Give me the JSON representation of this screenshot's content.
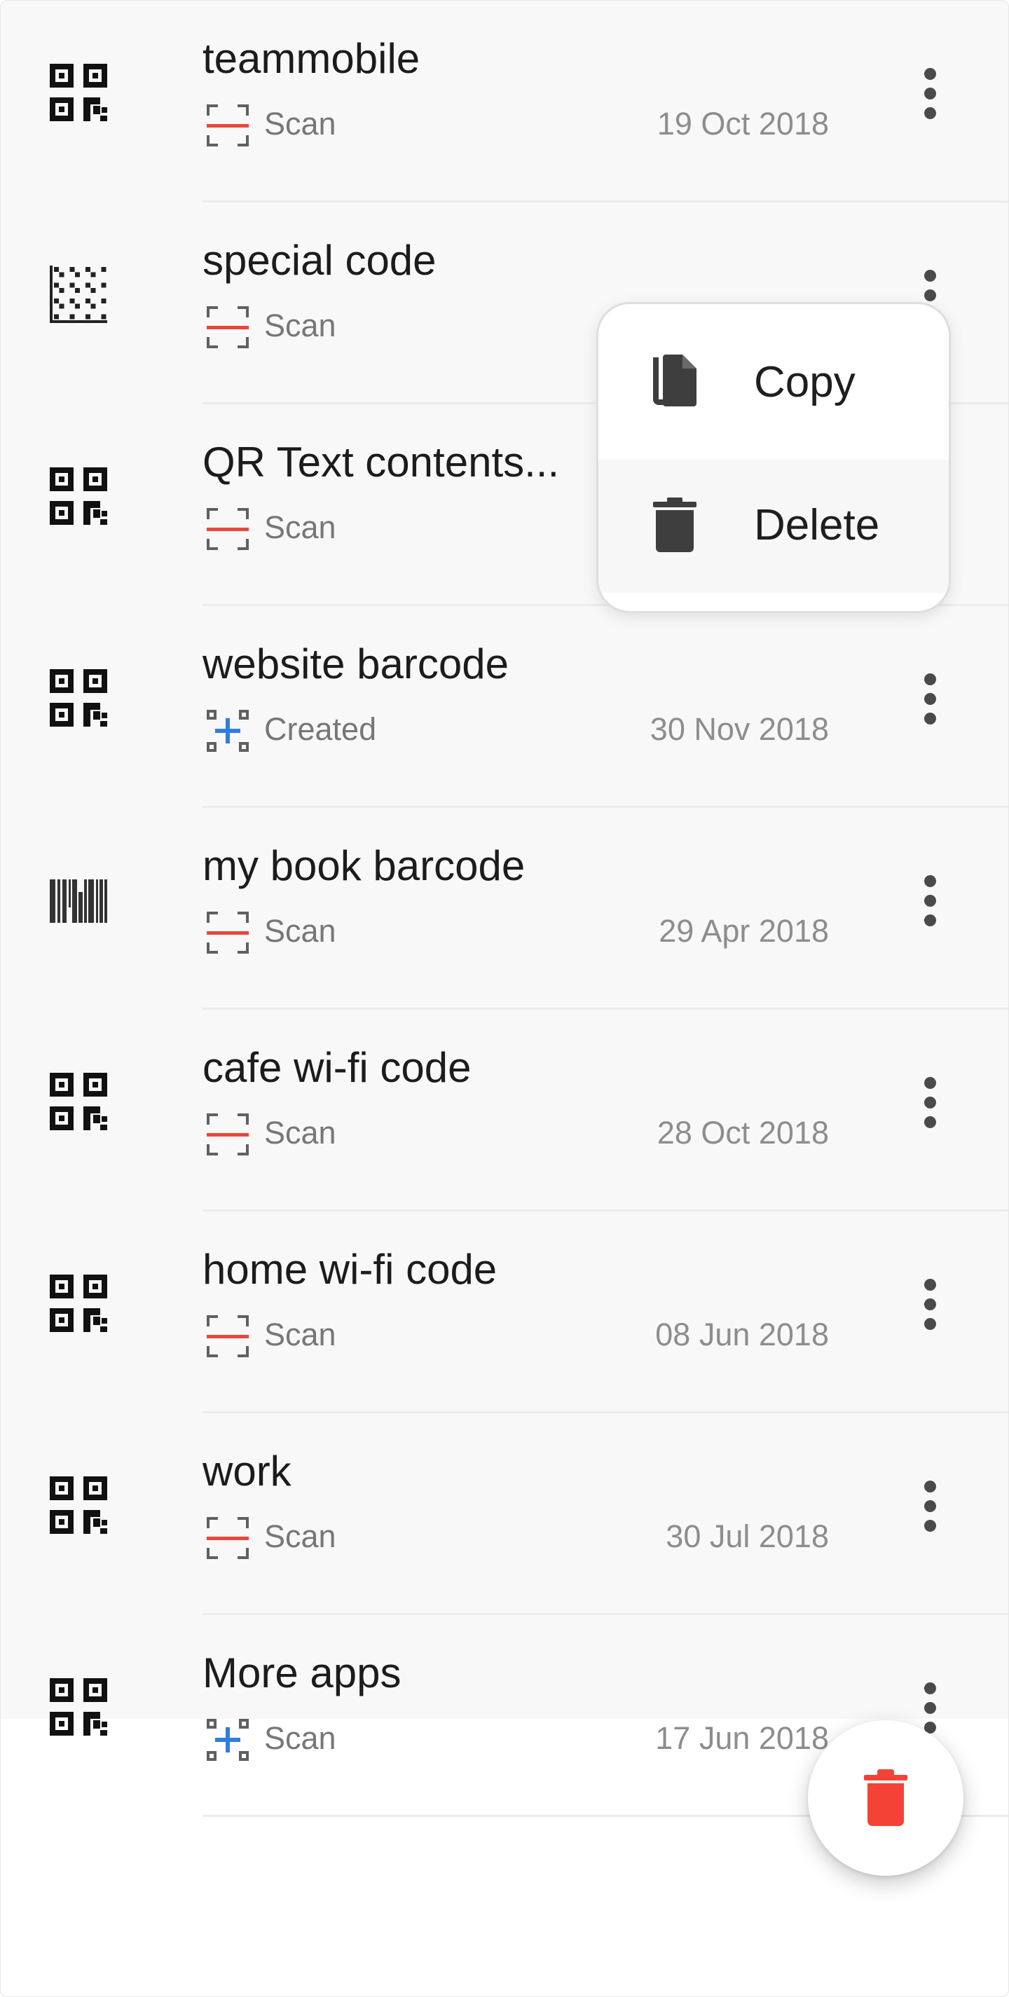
{
  "codes": [
    {
      "title": "teammobile",
      "code_type": "qr",
      "source_icon": "scan-icon",
      "source": "Scan",
      "date": "19 Oct 2018"
    },
    {
      "title": "special code",
      "code_type": "datamatrix",
      "source_icon": "scan-icon",
      "source": "Scan",
      "date": ""
    },
    {
      "title": "QR Text contents...",
      "code_type": "qr",
      "source_icon": "scan-icon",
      "source": "Scan",
      "date": ""
    },
    {
      "title": "website barcode",
      "code_type": "qr",
      "source_icon": "create-icon",
      "source": "Created",
      "date": "30 Nov 2018"
    },
    {
      "title": "my book barcode",
      "code_type": "barcode",
      "source_icon": "scan-icon",
      "source": "Scan",
      "date": "29 Apr 2018"
    },
    {
      "title": "cafe wi-fi code",
      "code_type": "qr",
      "source_icon": "scan-icon",
      "source": "Scan",
      "date": "28 Oct 2018"
    },
    {
      "title": "home wi-fi code",
      "code_type": "qr",
      "source_icon": "scan-icon",
      "source": "Scan",
      "date": "08 Jun 2018"
    },
    {
      "title": "work",
      "code_type": "qr",
      "source_icon": "scan-icon",
      "source": "Scan",
      "date": "30 Jul 2018"
    },
    {
      "title": "More apps",
      "code_type": "qr",
      "source_icon": "create-icon",
      "source": "Scan",
      "date": "17 Jun 2018"
    }
  ],
  "context_menu": {
    "copy_label": "Copy",
    "delete_label": "Delete"
  },
  "fab": {
    "icon": "trash-icon",
    "color": "#f44336"
  },
  "colors": {
    "scan_accent": "#e8473a",
    "create_accent": "#2f7de1",
    "list_background": "#f8f8f8"
  }
}
